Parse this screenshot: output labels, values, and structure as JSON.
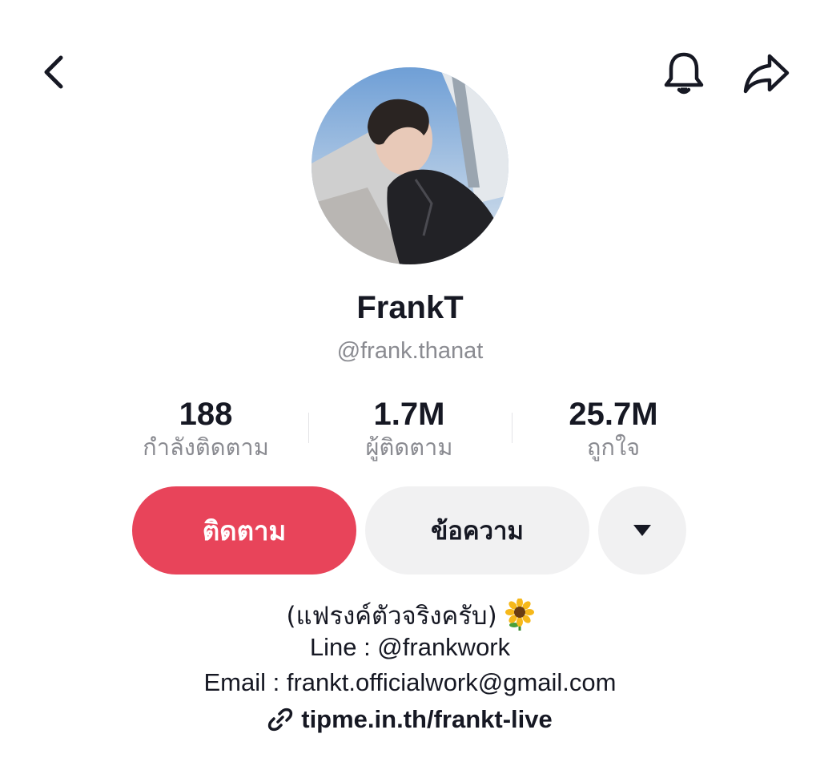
{
  "profile": {
    "display_name": "FrankT",
    "handle": "@frank.thanat"
  },
  "stats": {
    "following": {
      "value": "188",
      "label": "กำลังติดตาม"
    },
    "followers": {
      "value": "1.7M",
      "label": "ผู้ติดตาม"
    },
    "likes": {
      "value": "25.7M",
      "label": "ถูกใจ"
    }
  },
  "actions": {
    "follow_label": "ติดตาม",
    "message_label": "ข้อความ"
  },
  "bio": {
    "line1": "(แฟรงค์ตัวจริงครับ)",
    "line2": "Line : @frankwork",
    "line3": "Email : frankt.officialwork@gmail.com",
    "link": "tipme.in.th/frankt-live"
  },
  "icons": {
    "back": "chevron-left-icon",
    "bell": "bell-icon",
    "share": "share-arrow-icon",
    "more": "caret-down-icon",
    "link": "link-icon",
    "emoji": "sunflower-icon"
  },
  "colors": {
    "accent": "#e8445a",
    "secondary_button": "#f1f1f2",
    "muted_text": "#8a8b91"
  }
}
